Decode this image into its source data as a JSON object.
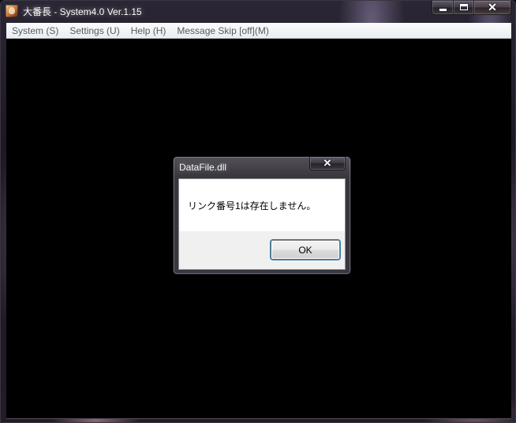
{
  "window": {
    "title": "大番長 - System4.0 Ver.1.15",
    "icon": "app-portrait-icon",
    "controls": {
      "minimize": "minimize-icon",
      "maximize": "maximize-icon",
      "close_glyph": "✕"
    }
  },
  "menu": {
    "items": [
      "System (S)",
      "Settings (U)",
      "Help (H)",
      "Message Skip [off](M)"
    ]
  },
  "dialog": {
    "title": "DataFile.dll",
    "message": "リンク番号1は存在しません。",
    "close_glyph": "✕",
    "ok_label": "OK"
  },
  "colors": {
    "client_background": "#000000",
    "dialog_body": "#ffffff",
    "dialog_footer": "#f0f0f0",
    "menu_text": "#5a5a5a"
  }
}
